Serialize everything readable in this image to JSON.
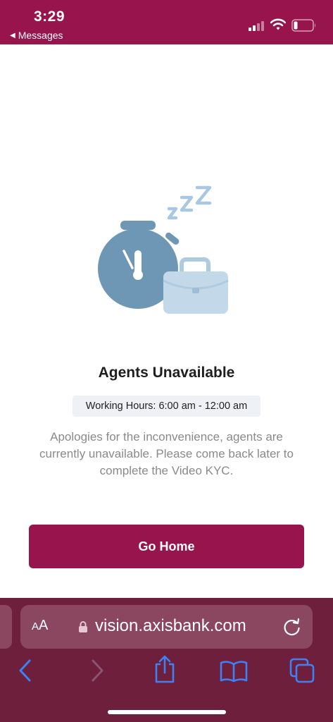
{
  "status_bar": {
    "time": "3:29",
    "back_label": "Messages"
  },
  "main": {
    "title": "Agents Unavailable",
    "working_hours": "Working Hours: 6:00 am - 12:00 am",
    "description": "Apologies for the inconvenience, agents are currently unavailable. Please come back later to complete the Video KYC.",
    "go_home_label": "Go Home"
  },
  "browser": {
    "text_size_label_small": "A",
    "text_size_label_large": "A",
    "url": "vision.axisbank.com"
  },
  "icons": {
    "illustration": "stopwatch-briefcase-sleep-illustration",
    "lock": "lock-icon",
    "reload": "reload-icon",
    "back": "back-arrow-icon",
    "forward": "forward-arrow-icon",
    "share": "share-icon",
    "bookmarks": "book-icon",
    "tabs": "tabs-icon"
  },
  "colors": {
    "brand": "#97144d",
    "browser_bar": "#6d1f3b",
    "toolbar_icon": "#3b82f6"
  }
}
